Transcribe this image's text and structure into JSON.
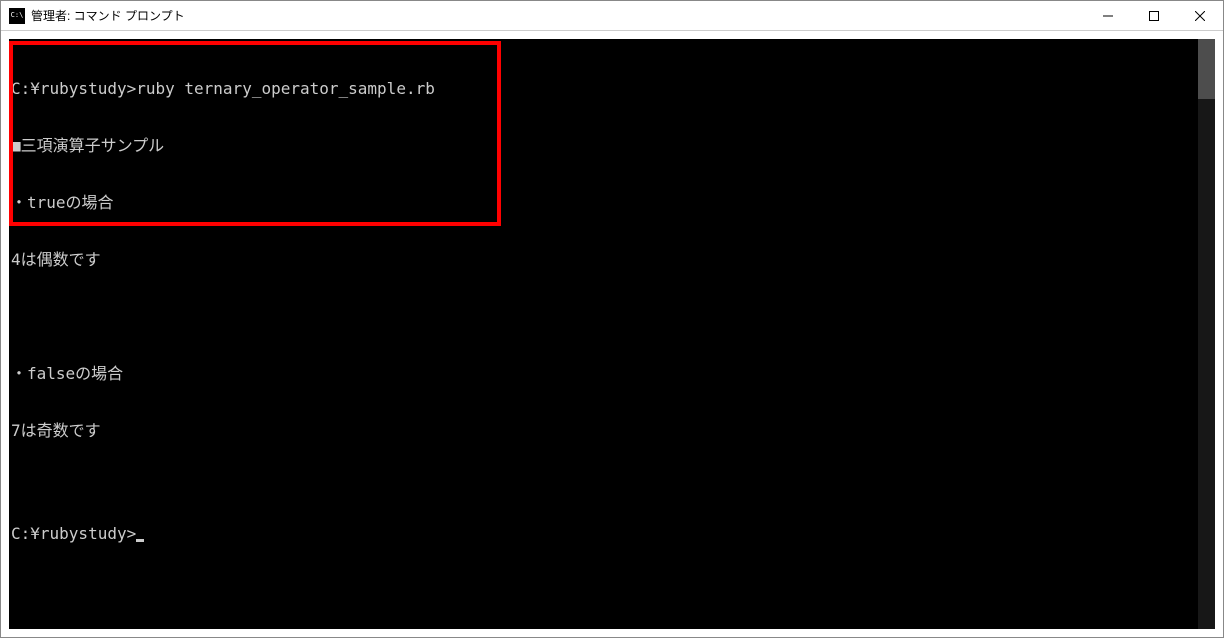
{
  "window": {
    "title": "管理者: コマンド プロンプト"
  },
  "terminal": {
    "lines": [
      "C:¥rubystudy>ruby ternary_operator_sample.rb",
      "■三項演算子サンプル",
      "・trueの場合",
      "4は偶数です",
      "",
      "・falseの場合",
      "7は奇数です"
    ],
    "prompt": "C:¥rubystudy>"
  }
}
